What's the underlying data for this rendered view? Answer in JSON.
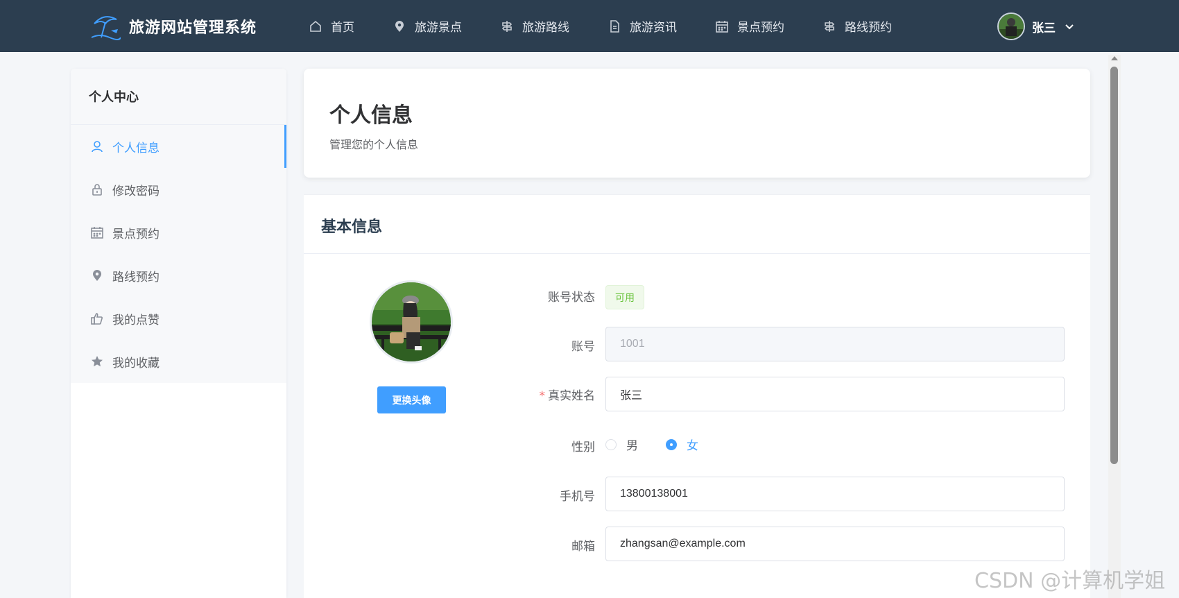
{
  "header": {
    "logo_text": "旅游网站管理系统",
    "nav": [
      {
        "label": "首页",
        "icon": "home-icon"
      },
      {
        "label": "旅游景点",
        "icon": "location-icon"
      },
      {
        "label": "旅游路线",
        "icon": "route-icon"
      },
      {
        "label": "旅游资讯",
        "icon": "document-icon"
      },
      {
        "label": "景点预约",
        "icon": "calendar-icon"
      },
      {
        "label": "路线预约",
        "icon": "route-icon"
      }
    ],
    "user_name": "张三"
  },
  "sidebar": {
    "title": "个人中心",
    "items": [
      {
        "label": "个人信息",
        "icon": "user-icon",
        "active": true
      },
      {
        "label": "修改密码",
        "icon": "lock-icon",
        "active": false
      },
      {
        "label": "景点预约",
        "icon": "calendar-icon",
        "active": false
      },
      {
        "label": "路线预约",
        "icon": "location-icon",
        "active": false
      },
      {
        "label": "我的点赞",
        "icon": "thumb-up-icon",
        "active": false
      },
      {
        "label": "我的收藏",
        "icon": "star-icon",
        "active": false
      }
    ]
  },
  "main": {
    "title": "个人信息",
    "subtitle": "管理您的个人信息",
    "section_title": "基本信息",
    "avatar_button": "更换头像",
    "fields": {
      "status_label": "账号状态",
      "status_value": "可用",
      "account_label": "账号",
      "account_value": "1001",
      "name_required": "*",
      "name_label": "真实姓名",
      "name_value": "张三",
      "gender_label": "性别",
      "gender_male": "男",
      "gender_female": "女",
      "gender_selected": "女",
      "phone_label": "手机号",
      "phone_value": "13800138001",
      "email_label": "邮箱",
      "email_value": "zhangsan@example.com"
    }
  },
  "watermark": "CSDN @计算机学姐",
  "colors": {
    "header_bg": "#2c3e50",
    "accent": "#409eff",
    "success": "#67c23a",
    "required": "#f56c6c"
  }
}
